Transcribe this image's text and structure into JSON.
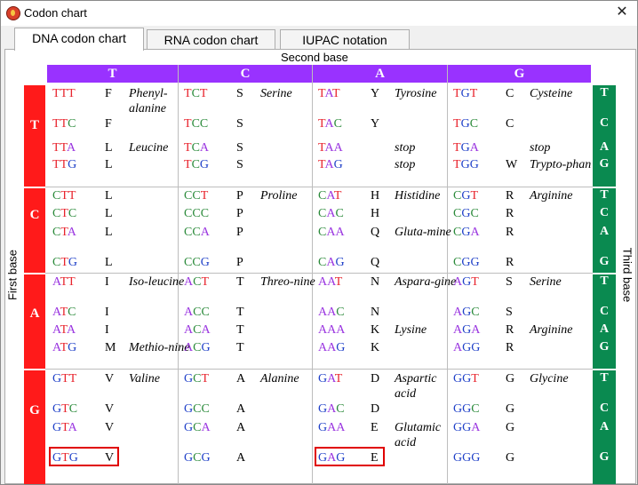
{
  "window": {
    "title": "Codon chart",
    "close": "✕"
  },
  "tabs": [
    {
      "label": "DNA codon chart",
      "active": true
    },
    {
      "label": "RNA codon chart",
      "active": false
    },
    {
      "label": "IUPAC notation",
      "active": false
    }
  ],
  "labels": {
    "second_base": "Second base",
    "first_base": "First base",
    "third_base": "Third base"
  },
  "bases": [
    "T",
    "C",
    "A",
    "G"
  ],
  "colors": {
    "T": "#e8242d",
    "C": "#2a8a3a",
    "A": "#9a35e0",
    "G": "#1f40c8"
  },
  "rows": [
    {
      "first": "T",
      "cells": [
        [
          {
            "c": "TTT",
            "a": "F",
            "n": "Phenyl-alanine"
          },
          {
            "c": "TTC",
            "a": "F"
          },
          {
            "c": "TTA",
            "a": "L",
            "n": "Leucine"
          },
          {
            "c": "TTG",
            "a": "L"
          }
        ],
        [
          {
            "c": "TCT",
            "a": "S",
            "n": "Serine"
          },
          {
            "c": "TCC",
            "a": "S"
          },
          {
            "c": "TCA",
            "a": "S"
          },
          {
            "c": "TCG",
            "a": "S"
          }
        ],
        [
          {
            "c": "TAT",
            "a": "Y",
            "n": "Tyrosine"
          },
          {
            "c": "TAC",
            "a": "Y"
          },
          {
            "c": "TAA",
            "a": "",
            "n": "stop"
          },
          {
            "c": "TAG",
            "a": "",
            "n": "stop"
          }
        ],
        [
          {
            "c": "TGT",
            "a": "C",
            "n": "Cysteine"
          },
          {
            "c": "TGC",
            "a": "C"
          },
          {
            "c": "TGA",
            "a": "",
            "n": "stop"
          },
          {
            "c": "TGG",
            "a": "W",
            "n": "Trypto-phan"
          }
        ]
      ]
    },
    {
      "first": "C",
      "cells": [
        [
          {
            "c": "CTT",
            "a": "L"
          },
          {
            "c": "CTC",
            "a": "L"
          },
          {
            "c": "CTA",
            "a": "L"
          },
          {
            "c": "CTG",
            "a": "L"
          }
        ],
        [
          {
            "c": "CCT",
            "a": "P",
            "n": "Proline"
          },
          {
            "c": "CCC",
            "a": "P"
          },
          {
            "c": "CCA",
            "a": "P"
          },
          {
            "c": "CCG",
            "a": "P"
          }
        ],
        [
          {
            "c": "CAT",
            "a": "H",
            "n": "Histidine"
          },
          {
            "c": "CAC",
            "a": "H"
          },
          {
            "c": "CAA",
            "a": "Q",
            "n": "Gluta-mine"
          },
          {
            "c": "CAG",
            "a": "Q"
          }
        ],
        [
          {
            "c": "CGT",
            "a": "R",
            "n": "Arginine"
          },
          {
            "c": "CGC",
            "a": "R"
          },
          {
            "c": "CGA",
            "a": "R"
          },
          {
            "c": "CGG",
            "a": "R"
          }
        ]
      ]
    },
    {
      "first": "A",
      "cells": [
        [
          {
            "c": "ATT",
            "a": "I",
            "n": "Iso-leucine"
          },
          {
            "c": "ATC",
            "a": "I"
          },
          {
            "c": "ATA",
            "a": "I"
          },
          {
            "c": "ATG",
            "a": "M",
            "n": "Methio-nine"
          }
        ],
        [
          {
            "c": "ACT",
            "a": "T",
            "n": "Threo-nine"
          },
          {
            "c": "ACC",
            "a": "T"
          },
          {
            "c": "ACA",
            "a": "T"
          },
          {
            "c": "ACG",
            "a": "T"
          }
        ],
        [
          {
            "c": "AAT",
            "a": "N",
            "n": "Asparа-gine"
          },
          {
            "c": "AAC",
            "a": "N"
          },
          {
            "c": "AAA",
            "a": "K",
            "n": "Lysine"
          },
          {
            "c": "AAG",
            "a": "K"
          }
        ],
        [
          {
            "c": "AGT",
            "a": "S",
            "n": "Serine"
          },
          {
            "c": "AGC",
            "a": "S"
          },
          {
            "c": "AGA",
            "a": "R",
            "n": "Arginine"
          },
          {
            "c": "AGG",
            "a": "R"
          }
        ]
      ]
    },
    {
      "first": "G",
      "cells": [
        [
          {
            "c": "GTT",
            "a": "V",
            "n": "Valine"
          },
          {
            "c": "GTC",
            "a": "V"
          },
          {
            "c": "GTA",
            "a": "V"
          },
          {
            "c": "GTG",
            "a": "V",
            "hl": true
          }
        ],
        [
          {
            "c": "GCT",
            "a": "A",
            "n": "Alanine"
          },
          {
            "c": "GCC",
            "a": "A"
          },
          {
            "c": "GCA",
            "a": "A"
          },
          {
            "c": "GCG",
            "a": "A"
          }
        ],
        [
          {
            "c": "GAT",
            "a": "D",
            "n": "Aspartic acid"
          },
          {
            "c": "GAC",
            "a": "D"
          },
          {
            "c": "GAA",
            "a": "E",
            "n": "Glutamic acid"
          },
          {
            "c": "GAG",
            "a": "E",
            "hl": true
          }
        ],
        [
          {
            "c": "GGT",
            "a": "G",
            "n": "Glycine"
          },
          {
            "c": "GGC",
            "a": "G"
          },
          {
            "c": "GGA",
            "a": "G"
          },
          {
            "c": "GGG",
            "a": "G"
          }
        ]
      ]
    }
  ]
}
